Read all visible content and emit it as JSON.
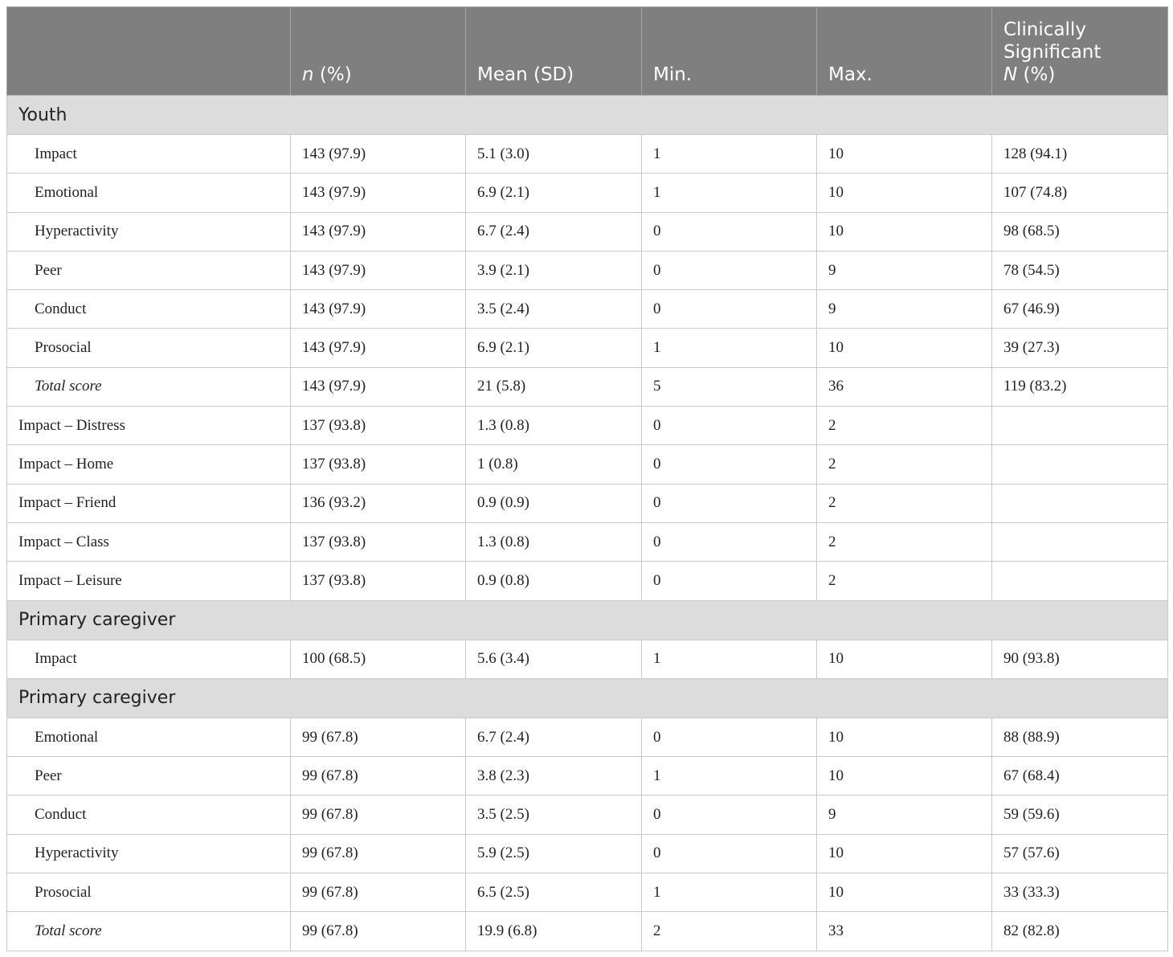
{
  "header": {
    "col0": "",
    "col1_italic": "n",
    "col1_rest": " (%)",
    "col2": "Mean (SD)",
    "col3": "Min.",
    "col4": "Max.",
    "col5_line1": "Clinically",
    "col5_line2": "Significant",
    "col5_italic": "N",
    "col5_rest": " (%)"
  },
  "rows": [
    {
      "type": "section",
      "label": "Youth"
    },
    {
      "type": "data",
      "label": "Impact",
      "indent": true,
      "italic": false,
      "n": "143 (97.9)",
      "mean": "5.1 (3.0)",
      "min": "1",
      "max": "10",
      "sig": "128 (94.1)"
    },
    {
      "type": "data",
      "label": "Emotional",
      "indent": true,
      "italic": false,
      "n": "143 (97.9)",
      "mean": "6.9 (2.1)",
      "min": "1",
      "max": "10",
      "sig": "107 (74.8)"
    },
    {
      "type": "data",
      "label": "Hyperactivity",
      "indent": true,
      "italic": false,
      "n": "143 (97.9)",
      "mean": "6.7 (2.4)",
      "min": "0",
      "max": "10",
      "sig": "98 (68.5)"
    },
    {
      "type": "data",
      "label": "Peer",
      "indent": true,
      "italic": false,
      "n": "143 (97.9)",
      "mean": "3.9 (2.1)",
      "min": "0",
      "max": "9",
      "sig": "78 (54.5)"
    },
    {
      "type": "data",
      "label": "Conduct",
      "indent": true,
      "italic": false,
      "n": "143 (97.9)",
      "mean": "3.5 (2.4)",
      "min": "0",
      "max": "9",
      "sig": "67 (46.9)"
    },
    {
      "type": "data",
      "label": "Prosocial",
      "indent": true,
      "italic": false,
      "n": "143 (97.9)",
      "mean": "6.9 (2.1)",
      "min": "1",
      "max": "10",
      "sig": "39 (27.3)"
    },
    {
      "type": "data",
      "label": "Total score",
      "indent": true,
      "italic": true,
      "n": "143 (97.9)",
      "mean": "21 (5.8)",
      "min": "5",
      "max": "36",
      "sig": "119 (83.2)"
    },
    {
      "type": "data",
      "label": "Impact – Distress",
      "indent": false,
      "italic": false,
      "n": "137 (93.8)",
      "mean": "1.3 (0.8)",
      "min": "0",
      "max": "2",
      "sig": ""
    },
    {
      "type": "data",
      "label": "Impact – Home",
      "indent": false,
      "italic": false,
      "n": "137 (93.8)",
      "mean": "1 (0.8)",
      "min": "0",
      "max": "2",
      "sig": ""
    },
    {
      "type": "data",
      "label": "Impact – Friend",
      "indent": false,
      "italic": false,
      "n": "136 (93.2)",
      "mean": "0.9 (0.9)",
      "min": "0",
      "max": "2",
      "sig": ""
    },
    {
      "type": "data",
      "label": "Impact – Class",
      "indent": false,
      "italic": false,
      "n": "137 (93.8)",
      "mean": "1.3 (0.8)",
      "min": "0",
      "max": "2",
      "sig": ""
    },
    {
      "type": "data",
      "label": "Impact – Leisure",
      "indent": false,
      "italic": false,
      "n": "137 (93.8)",
      "mean": "0.9 (0.8)",
      "min": "0",
      "max": "2",
      "sig": ""
    },
    {
      "type": "section",
      "label": "Primary caregiver"
    },
    {
      "type": "data",
      "label": "Impact",
      "indent": true,
      "italic": false,
      "n": "100 (68.5)",
      "mean": "5.6 (3.4)",
      "min": "1",
      "max": "10",
      "sig": "90 (93.8)"
    },
    {
      "type": "section",
      "label": "Primary caregiver"
    },
    {
      "type": "data",
      "label": "Emotional",
      "indent": true,
      "italic": false,
      "n": "99 (67.8)",
      "mean": "6.7 (2.4)",
      "min": "0",
      "max": "10",
      "sig": "88 (88.9)"
    },
    {
      "type": "data",
      "label": "Peer",
      "indent": true,
      "italic": false,
      "n": "99 (67.8)",
      "mean": "3.8 (2.3)",
      "min": "1",
      "max": "10",
      "sig": "67 (68.4)"
    },
    {
      "type": "data",
      "label": "Conduct",
      "indent": true,
      "italic": false,
      "n": "99 (67.8)",
      "mean": "3.5 (2.5)",
      "min": "0",
      "max": "9",
      "sig": "59 (59.6)"
    },
    {
      "type": "data",
      "label": "Hyperactivity",
      "indent": true,
      "italic": false,
      "n": "99 (67.8)",
      "mean": "5.9 (2.5)",
      "min": "0",
      "max": "10",
      "sig": "57 (57.6)"
    },
    {
      "type": "data",
      "label": "Prosocial",
      "indent": true,
      "italic": false,
      "n": "99 (67.8)",
      "mean": "6.5 (2.5)",
      "min": "1",
      "max": "10",
      "sig": "33 (33.3)"
    },
    {
      "type": "data",
      "label": "Total score",
      "indent": true,
      "italic": true,
      "n": "99 (67.8)",
      "mean": "19.9 (6.8)",
      "min": "2",
      "max": "33",
      "sig": "82 (82.8)"
    }
  ]
}
